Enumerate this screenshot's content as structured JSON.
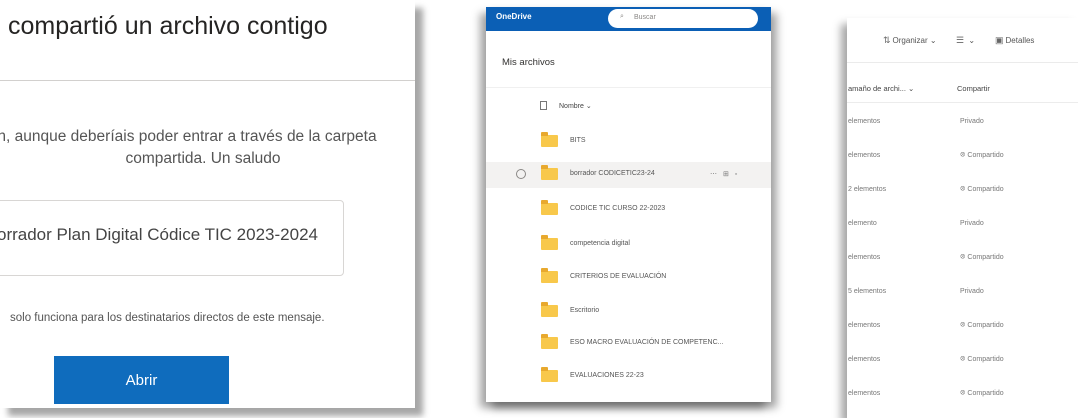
{
  "email": {
    "subject": "compartió un archivo contigo",
    "body_line1": "n, aunque deberíais poder entrar a través de la carpeta",
    "body_line2": "compartida. Un saludo",
    "attachment_name": "orrador Plan Digital Códice TIC 2023-2024",
    "notice": "solo funciona para los destinatarios directos de este mensaje.",
    "open_button": "Abrir"
  },
  "onedrive": {
    "brand": "OneDrive",
    "search_placeholder": "Buscar",
    "title": "Mis archivos",
    "column_name": "Nombre",
    "folders": [
      "BITS",
      "borrador CODICETIC23-24",
      "CODICE TIC CURSO 22-2023",
      "competencia digital",
      "CRITERIOS DE EVALUACIÓN",
      "Escritorio",
      "ESO MACRO EVALUACIÓN DE COMPETENC...",
      "EVALUACIONES 22-23"
    ],
    "accent": "#0b5fb5",
    "folder_color": "#f8c84b"
  },
  "details": {
    "toolbar": {
      "organize": "Organizar",
      "view": "",
      "details": "Detalles"
    },
    "columns": {
      "size": "amaño de archi...",
      "share": "Compartir"
    },
    "rows": [
      {
        "size": "elementos",
        "share": "Privado"
      },
      {
        "size": "elementos",
        "share": "Compartido"
      },
      {
        "size": "2 elementos",
        "share": "Compartido"
      },
      {
        "size": "elemento",
        "share": "Privado"
      },
      {
        "size": "elementos",
        "share": "Compartido"
      },
      {
        "size": "5 elementos",
        "share": "Privado"
      },
      {
        "size": "elementos",
        "share": "Compartido"
      },
      {
        "size": "elementos",
        "share": "Compartido"
      },
      {
        "size": "elementos",
        "share": "Compartido"
      }
    ]
  }
}
